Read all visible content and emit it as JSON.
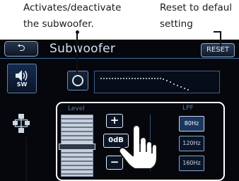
{
  "annotations": {
    "toggle_line1": "Activates/deactivate",
    "toggle_line2": "the subwoofer.",
    "reset_line1": "Reset to defaul",
    "reset_line2": "setting"
  },
  "screen": {
    "back_glyph": "⮌",
    "title": "Subwoofer",
    "reset_label": "RESET",
    "sw_icon_label": "SW",
    "icons": [
      "back-arrow-icon",
      "subwoofer-speaker-icon",
      "network-icon",
      "toggle-ring-icon",
      "hand-pointer-icon"
    ]
  },
  "level": {
    "label": "Level",
    "plus": "+",
    "minus": "−",
    "value_text": "0dB",
    "value_db": 0,
    "min_db": -6,
    "max_db": 6
  },
  "lpf": {
    "label": "LPF",
    "options": [
      "80Hz",
      "120Hz",
      "160Hz"
    ],
    "selected": "80Hz"
  },
  "colors": {
    "screen_bg": "#05070d",
    "frame_highlight": "#ffffff",
    "accent_blue": "#3c6f9f",
    "label_blue": "#5b7a9e"
  }
}
